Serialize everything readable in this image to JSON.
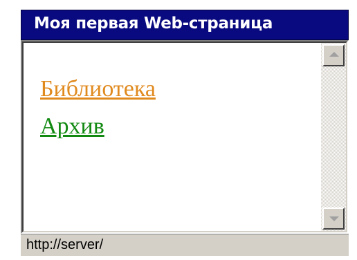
{
  "window": {
    "title": "Моя первая Web-страница"
  },
  "content": {
    "links": [
      {
        "label": "Библиотека",
        "color": "#e08a1e"
      },
      {
        "label": "Архив",
        "color": "#128a12"
      }
    ]
  },
  "scrollbar": {
    "up_icon": "arrow-up-icon",
    "down_icon": "arrow-down-icon"
  },
  "statusbar": {
    "text": "http://server/"
  },
  "colors": {
    "titlebar": "#0a0a80",
    "chrome": "#d4d0c8",
    "page_background": "#ffffff"
  }
}
